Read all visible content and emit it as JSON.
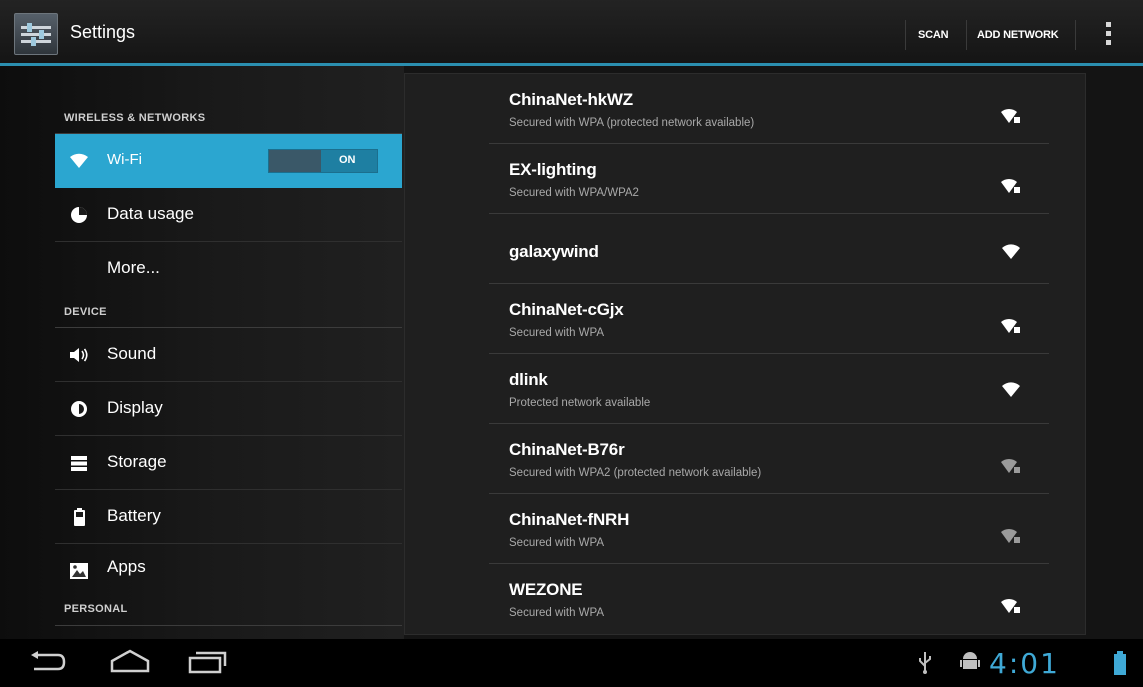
{
  "action_bar": {
    "title": "Settings",
    "scan_label": "SCAN",
    "add_network_label": "ADD NETWORK",
    "accent_color": "#2b8fb0"
  },
  "sidebar": {
    "sections": [
      {
        "header": "WIRELESS & NETWORKS"
      },
      {
        "header": "DEVICE"
      },
      {
        "header": "PERSONAL"
      }
    ],
    "items": [
      {
        "label": "Wi-Fi",
        "icon": "wifi-icon",
        "selected": true,
        "toggle_label": "ON"
      },
      {
        "label": "Data usage",
        "icon": "data-usage-icon"
      },
      {
        "label": "More...",
        "icon": ""
      },
      {
        "label": "Sound",
        "icon": "speaker-icon"
      },
      {
        "label": "Display",
        "icon": "display-icon"
      },
      {
        "label": "Storage",
        "icon": "storage-icon"
      },
      {
        "label": "Battery",
        "icon": "battery-icon"
      },
      {
        "label": "Apps",
        "icon": "apps-icon"
      }
    ],
    "selected_color": "#2ba6d0"
  },
  "networks": [
    {
      "name": "ChinaNet-hkWZ",
      "status": "Secured with WPA (protected network available)",
      "secured": true
    },
    {
      "name": "EX-lighting",
      "status": "Secured with WPA/WPA2",
      "secured": true
    },
    {
      "name": "galaxywind",
      "status": "",
      "secured": false
    },
    {
      "name": "ChinaNet-cGjx",
      "status": "Secured with WPA",
      "secured": true
    },
    {
      "name": "dlink",
      "status": "Protected network available",
      "secured": false
    },
    {
      "name": "ChinaNet-B76r",
      "status": "Secured with WPA2 (protected network available)",
      "secured": true
    },
    {
      "name": "ChinaNet-fNRH",
      "status": "Secured with WPA",
      "secured": true
    },
    {
      "name": "WEZONE",
      "status": "Secured with WPA",
      "secured": true
    }
  ],
  "nav_bar": {
    "clock": "4:01",
    "icons": [
      "back-icon",
      "home-icon",
      "recent-apps-icon",
      "usb-icon",
      "android-debug-icon",
      "battery-status-icon"
    ]
  }
}
